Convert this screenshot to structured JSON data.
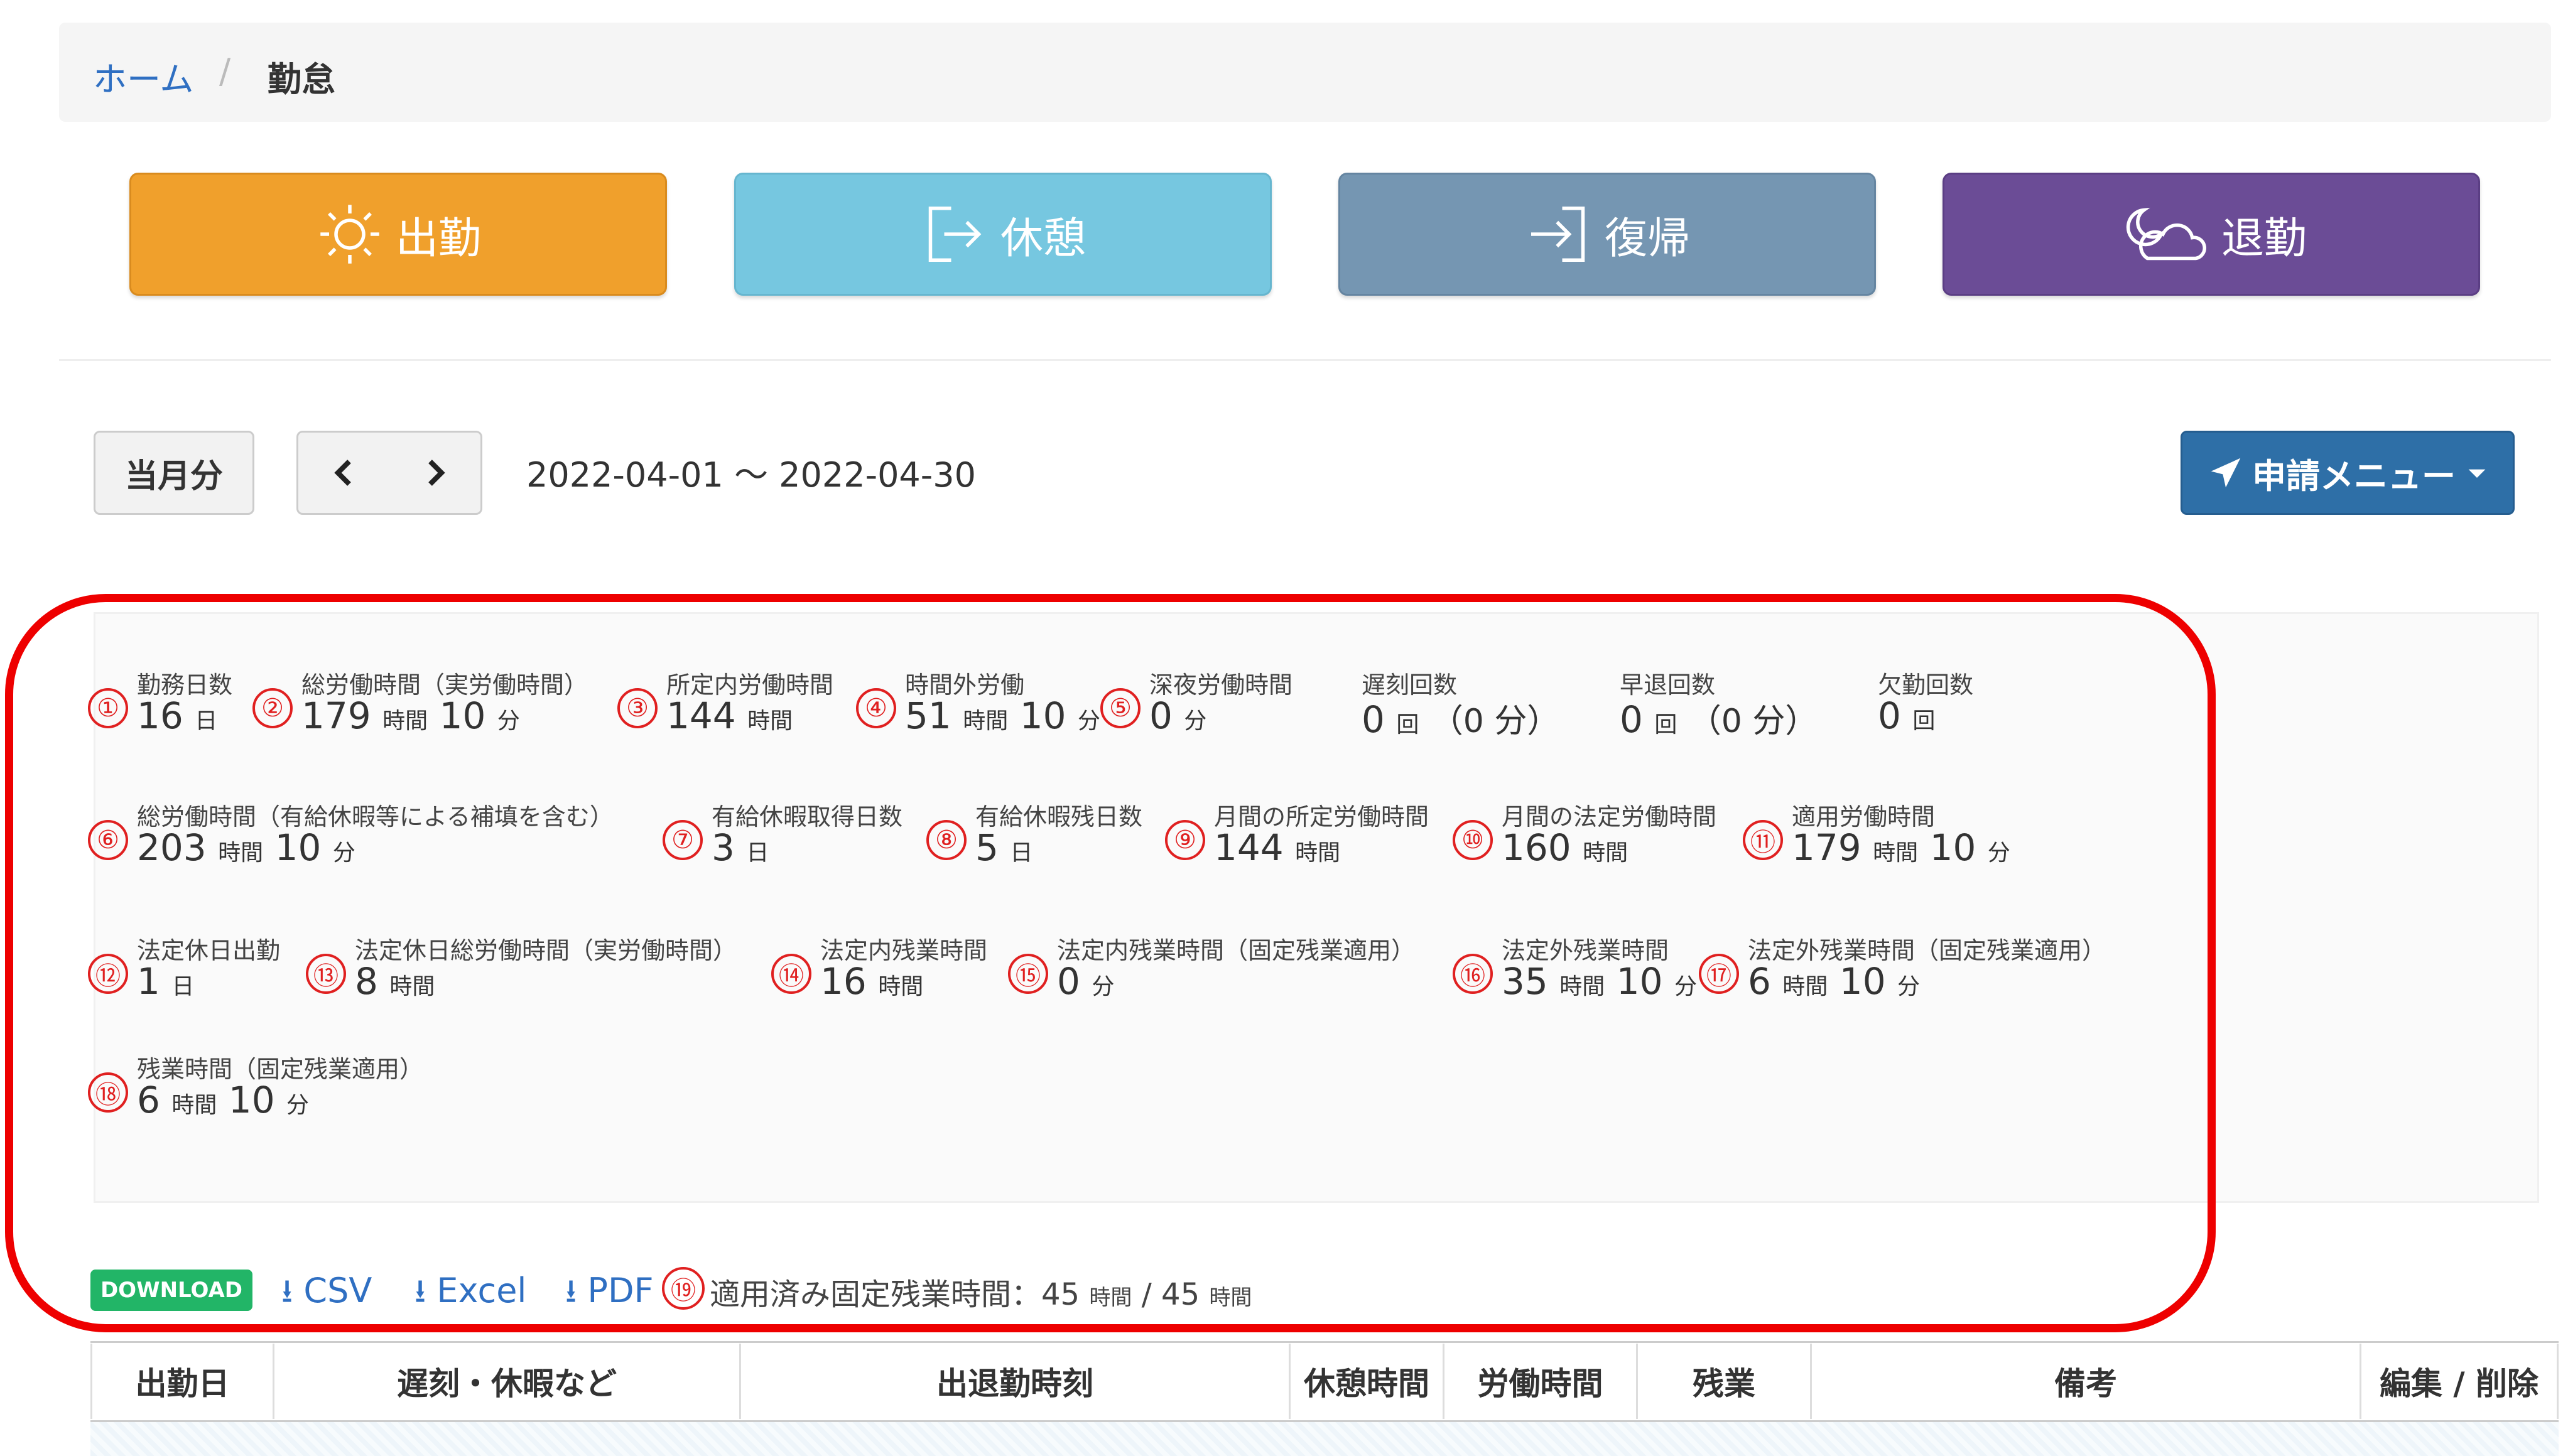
{
  "breadcrumb": {
    "home": "ホーム",
    "separator": "/",
    "current": "勤怠"
  },
  "actions": {
    "clock_in": "出勤",
    "break": "休憩",
    "return": "復帰",
    "clock_out": "退勤"
  },
  "toolbar": {
    "current_month": "当月分",
    "range": "2022-04-01 ～ 2022-04-30",
    "apply_menu": "申請メニュー"
  },
  "stats": [
    {
      "num": "①",
      "label": "勤務日数",
      "value": "16",
      "unit": "日"
    },
    {
      "num": "②",
      "label": "総労働時間（実労働時間）",
      "value": "179",
      "unit": "時間",
      "value2": "10",
      "unit2": "分"
    },
    {
      "num": "③",
      "label": "所定内労働時間",
      "value": "144",
      "unit": "時間"
    },
    {
      "num": "④",
      "label": "時間外労働",
      "value": "51",
      "unit": "時間",
      "value2": "10",
      "unit2": "分"
    },
    {
      "num": "⑤",
      "label": "深夜労働時間",
      "value": "0",
      "unit": "分"
    },
    {
      "num": "",
      "label": "遅刻回数",
      "value": "0",
      "unit": "回",
      "extra": "（0 分）"
    },
    {
      "num": "",
      "label": "早退回数",
      "value": "0",
      "unit": "回",
      "extra": "（0 分）"
    },
    {
      "num": "",
      "label": "欠勤回数",
      "value": "0",
      "unit": "回"
    },
    {
      "num": "⑥",
      "label": "総労働時間（有給休暇等による補填を含む）",
      "value": "203",
      "unit": "時間",
      "value2": "10",
      "unit2": "分"
    },
    {
      "num": "⑦",
      "label": "有給休暇取得日数",
      "value": "3",
      "unit": "日"
    },
    {
      "num": "⑧",
      "label": "有給休暇残日数",
      "value": "5",
      "unit": "日"
    },
    {
      "num": "⑨",
      "label": "月間の所定労働時間",
      "value": "144",
      "unit": "時間"
    },
    {
      "num": "⑩",
      "label": "月間の法定労働時間",
      "value": "160",
      "unit": "時間"
    },
    {
      "num": "⑪",
      "label": "適用労働時間",
      "value": "179",
      "unit": "時間",
      "value2": "10",
      "unit2": "分"
    },
    {
      "num": "⑫",
      "label": "法定休日出勤",
      "value": "1",
      "unit": "日"
    },
    {
      "num": "⑬",
      "label": "法定休日総労働時間（実労働時間）",
      "value": "8",
      "unit": "時間"
    },
    {
      "num": "⑭",
      "label": "法定内残業時間",
      "value": "16",
      "unit": "時間"
    },
    {
      "num": "⑮",
      "label": "法定内残業時間（固定残業適用）",
      "value": "0",
      "unit": "分"
    },
    {
      "num": "⑯",
      "label": "法定外残業時間",
      "value": "35",
      "unit": "時間",
      "value2": "10",
      "unit2": "分"
    },
    {
      "num": "⑰",
      "label": "法定外残業時間（固定残業適用）",
      "value": "6",
      "unit": "時間",
      "value2": "10",
      "unit2": "分"
    },
    {
      "num": "⑱",
      "label": "残業時間（固定残業適用）",
      "value": "6",
      "unit": "時間",
      "value2": "10",
      "unit2": "分"
    }
  ],
  "download": {
    "badge": "DOWNLOAD",
    "csv": "CSV",
    "excel": "Excel",
    "pdf": "PDF",
    "num": "⑲",
    "fixed_ot_label": "適用済み固定残業時間：45",
    "fixed_ot_unit": "時間",
    "fixed_ot_sep": "/ 45",
    "fixed_ot_unit2": "時間"
  },
  "table": {
    "columns": [
      "出勤日",
      "遅刻・休暇など",
      "出退勤時刻",
      "休憩時間",
      "労働時間",
      "残業",
      "備考",
      "編集 / 削除"
    ]
  },
  "colors": {
    "clock_in": "#f0a02c",
    "break": "#76c7e0",
    "return": "#7596b2",
    "clock_out": "#6b4c96",
    "highlight": "#ee0000",
    "link": "#2f6fc2"
  }
}
